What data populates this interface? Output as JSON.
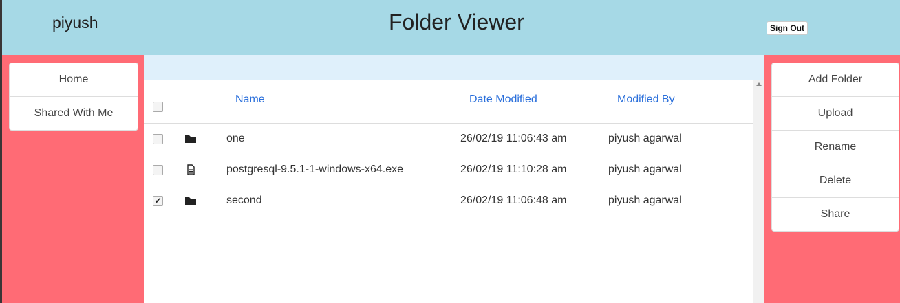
{
  "header": {
    "username": "piyush",
    "title": "Folder Viewer",
    "sign_out_label": "Sign Out"
  },
  "left_nav": {
    "items": [
      {
        "label": "Home"
      },
      {
        "label": "Shared With Me"
      }
    ]
  },
  "actions": {
    "items": [
      {
        "label": "Add Folder"
      },
      {
        "label": "Upload"
      },
      {
        "label": "Rename"
      },
      {
        "label": "Delete"
      },
      {
        "label": "Share"
      }
    ]
  },
  "table": {
    "columns": {
      "name": "Name",
      "date": "Date Modified",
      "by": "Modified By"
    },
    "select_all_checked": false,
    "rows": [
      {
        "checked": false,
        "icon": "folder-icon",
        "name": "one",
        "date": "26/02/19 11:06:43 am",
        "by": "piyush agarwal"
      },
      {
        "checked": false,
        "icon": "file-icon",
        "name": "postgresql-9.5.1-1-windows-x64.exe",
        "date": "26/02/19 11:10:28 am",
        "by": "piyush agarwal"
      },
      {
        "checked": true,
        "icon": "folder-icon",
        "name": "second",
        "date": "26/02/19 11:06:48 am",
        "by": "piyush agarwal"
      }
    ]
  },
  "colors": {
    "header_bg": "#a6d9e6",
    "side_bg": "#ff6b75",
    "link": "#2a6fdb",
    "main_top_band": "#dff0fb"
  }
}
